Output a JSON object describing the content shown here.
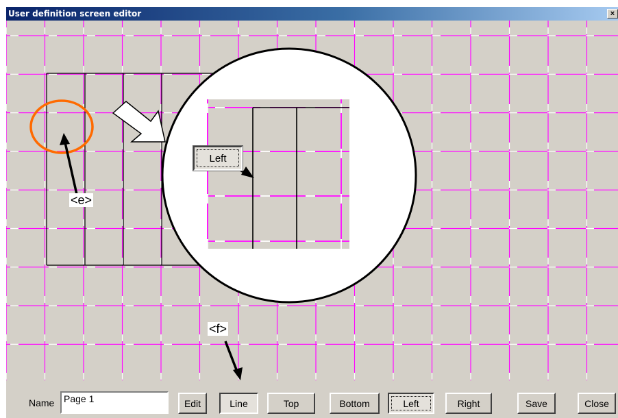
{
  "window": {
    "title": "User definition screen editor",
    "close_label": "×"
  },
  "toolbar": {
    "name_label": "Name",
    "name_value": "Page 1",
    "buttons": {
      "edit": "Edit",
      "line": "Line",
      "top": "Top",
      "bottom": "Bottom",
      "left": "Left",
      "right": "Right",
      "save": "Save",
      "close": "Close"
    }
  },
  "zoom_inset": {
    "left_button_label": "Left"
  },
  "callouts": {
    "e": "<e>",
    "f": "<f>"
  },
  "colors": {
    "grid_magenta": "#ff00ff",
    "grid_white_dash": "#ffffff",
    "drawn_line": "#000000",
    "highlight_circle": "#ff6a00",
    "surface": "#d4d0c8"
  },
  "icons": {
    "close": "close-icon",
    "pointer_arrow": "arrow-icon",
    "block_arrow": "block-arrow-icon"
  }
}
